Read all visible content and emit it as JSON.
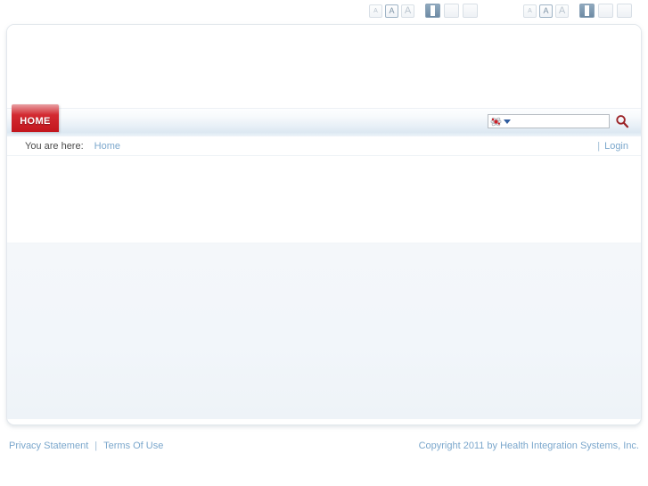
{
  "topbar": {
    "text_size_controls": {
      "label": "text-size",
      "options": [
        {
          "glyph": "A",
          "size": "small",
          "active": false
        },
        {
          "glyph": "A",
          "size": "medium",
          "active": true
        },
        {
          "glyph": "A",
          "size": "large",
          "active": false
        }
      ]
    },
    "layout_width_controls": {
      "label": "layout-width",
      "options": [
        {
          "name": "fixed",
          "active": true
        },
        {
          "name": "wide",
          "active": false
        },
        {
          "name": "full",
          "active": false
        }
      ]
    }
  },
  "nav": {
    "tabs": [
      {
        "label": "HOME",
        "active": true
      }
    ]
  },
  "search": {
    "value": "",
    "placeholder": "",
    "scope_icon": "site-search-icon",
    "dropdown_icon": "chevron-down-icon",
    "go_icon": "magnifier-icon"
  },
  "breadcrumb": {
    "label": "You are here:",
    "items": [
      {
        "label": "Home"
      }
    ],
    "separator": "|",
    "login_label": "Login"
  },
  "footer": {
    "links": [
      {
        "label": "Privacy Statement"
      },
      {
        "label": "Terms Of Use"
      }
    ],
    "separator": "|",
    "copyright": "Copyright 2011 by Health Integration Systems, Inc."
  },
  "colors": {
    "brand_red": "#c3161d",
    "link_blue": "#7ba7cc",
    "nav_blue": "#dce8f2",
    "panel_border": "#e3e8ed"
  }
}
